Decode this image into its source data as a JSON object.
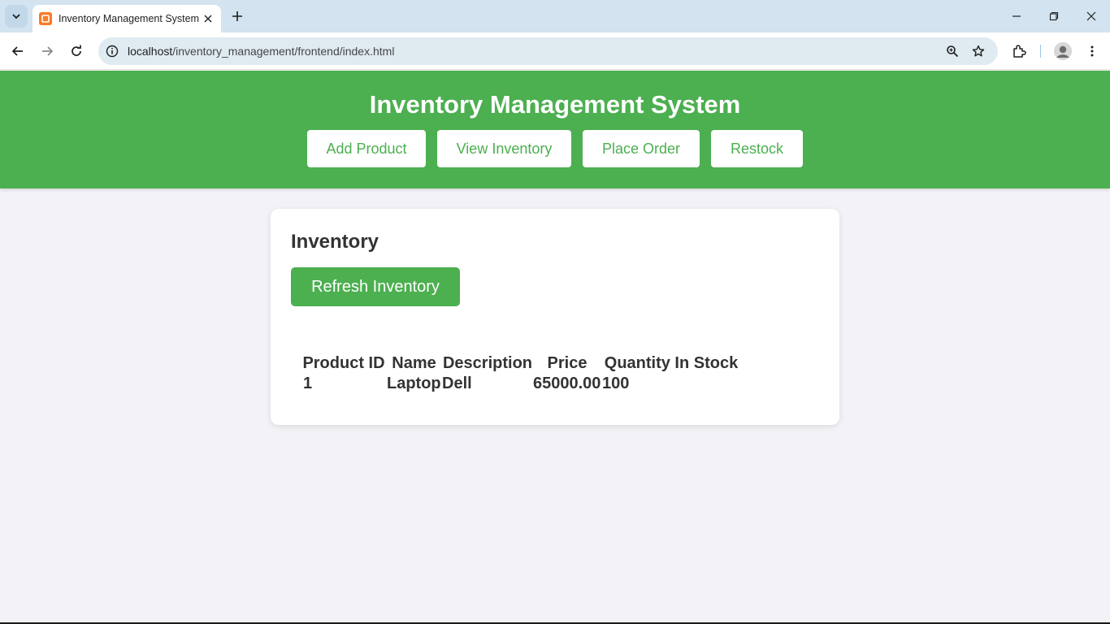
{
  "browser": {
    "tab_title": "Inventory Management System",
    "url_host": "localhost",
    "url_path": "/inventory_management/frontend/index.html",
    "icons": [
      "tab-search-icon",
      "favicon-icon",
      "close-icon",
      "plus-icon",
      "minimize-icon",
      "restore-icon",
      "window-close-icon",
      "back-icon",
      "forward-icon",
      "reload-icon",
      "info-icon",
      "zoom-icon",
      "star-icon",
      "extensions-icon",
      "profile-icon",
      "more-icon"
    ]
  },
  "header": {
    "title": "Inventory Management System",
    "nav": [
      "Add Product",
      "View Inventory",
      "Place Order",
      "Restock"
    ]
  },
  "inventory": {
    "heading": "Inventory",
    "refresh_label": "Refresh Inventory",
    "columns": [
      "Product ID",
      "Name",
      "Description",
      "Price",
      "Quantity In Stock"
    ],
    "rows": [
      [
        "1",
        "Laptop",
        "Dell",
        "65000.00",
        "100"
      ]
    ]
  },
  "colors": {
    "brand_green": "#4caf50",
    "page_bg": "#f3f3f7",
    "text_dark": "#333333"
  }
}
